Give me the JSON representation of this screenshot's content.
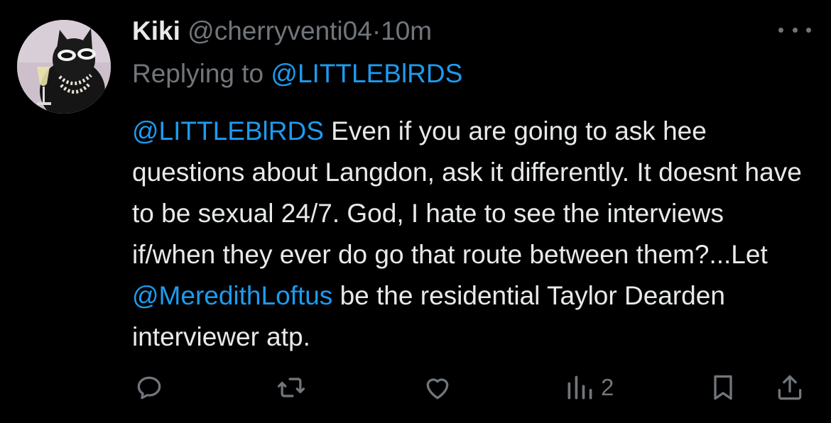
{
  "user": {
    "name": "Kiki",
    "handle": "@cherryventi04",
    "separator": "·",
    "time": "10m"
  },
  "reply": {
    "prefix": "Replying to",
    "target": "@LITTLEBlRDS"
  },
  "tweet": {
    "mention1": "@LITTLEBlRDS",
    "text1": " Even if you are going to ask hee questions about Langdon, ask it differently. It doesnt have to be sexual 24/7. God, I hate to see the interviews if/when they ever do go that route between them?...Let ",
    "mention2": "@MeredithLoftus",
    "text2": " be the residential Taylor Dearden interviewer atp."
  },
  "actions": {
    "reply_icon": "reply-icon",
    "retweet_icon": "retweet-icon",
    "like_icon": "heart-icon",
    "views_icon": "views-icon",
    "views_count": "2",
    "bookmark_icon": "bookmark-icon",
    "share_icon": "share-icon"
  },
  "colors": {
    "background": "#000000",
    "text": "#e7e9ea",
    "secondary": "#71767b",
    "link": "#1d9bf0"
  }
}
